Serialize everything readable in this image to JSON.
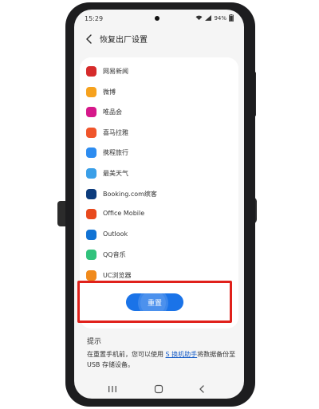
{
  "status": {
    "time": "15:29",
    "battery": "94%"
  },
  "header": {
    "title": "恢复出厂设置"
  },
  "apps": [
    {
      "name": "网易新闻",
      "icon": "netease-news-icon",
      "color": "#d62b2b"
    },
    {
      "name": "微博",
      "icon": "weibo-icon",
      "color": "#f6a21e"
    },
    {
      "name": "唯品会",
      "icon": "vipshop-icon",
      "color": "#d6188a"
    },
    {
      "name": "喜马拉雅",
      "icon": "ximalaya-icon",
      "color": "#f0552b"
    },
    {
      "name": "携程旅行",
      "icon": "ctrip-icon",
      "color": "#2d8cf0"
    },
    {
      "name": "最美天气",
      "icon": "weather-icon",
      "color": "#3a9fe8"
    },
    {
      "name": "Booking.com缤客",
      "icon": "booking-icon",
      "color": "#0c3b7c"
    },
    {
      "name": "Office Mobile",
      "icon": "office-icon",
      "color": "#e8491d"
    },
    {
      "name": "Outlook",
      "icon": "outlook-icon",
      "color": "#1173d4"
    },
    {
      "name": "QQ音乐",
      "icon": "qq-music-icon",
      "color": "#31c27c"
    },
    {
      "name": "UC浏览器",
      "icon": "uc-browser-icon",
      "color": "#f08a1c"
    }
  ],
  "reset_button": {
    "label": "重置"
  },
  "tips": {
    "title": "提示",
    "text_before": "在重置手机前，您可以使用 ",
    "link": "S 换机助手",
    "text_after": "将数据备份至 USB 存储设备。"
  },
  "colors": {
    "accent": "#1a73e8",
    "highlight": "#e0211b"
  }
}
